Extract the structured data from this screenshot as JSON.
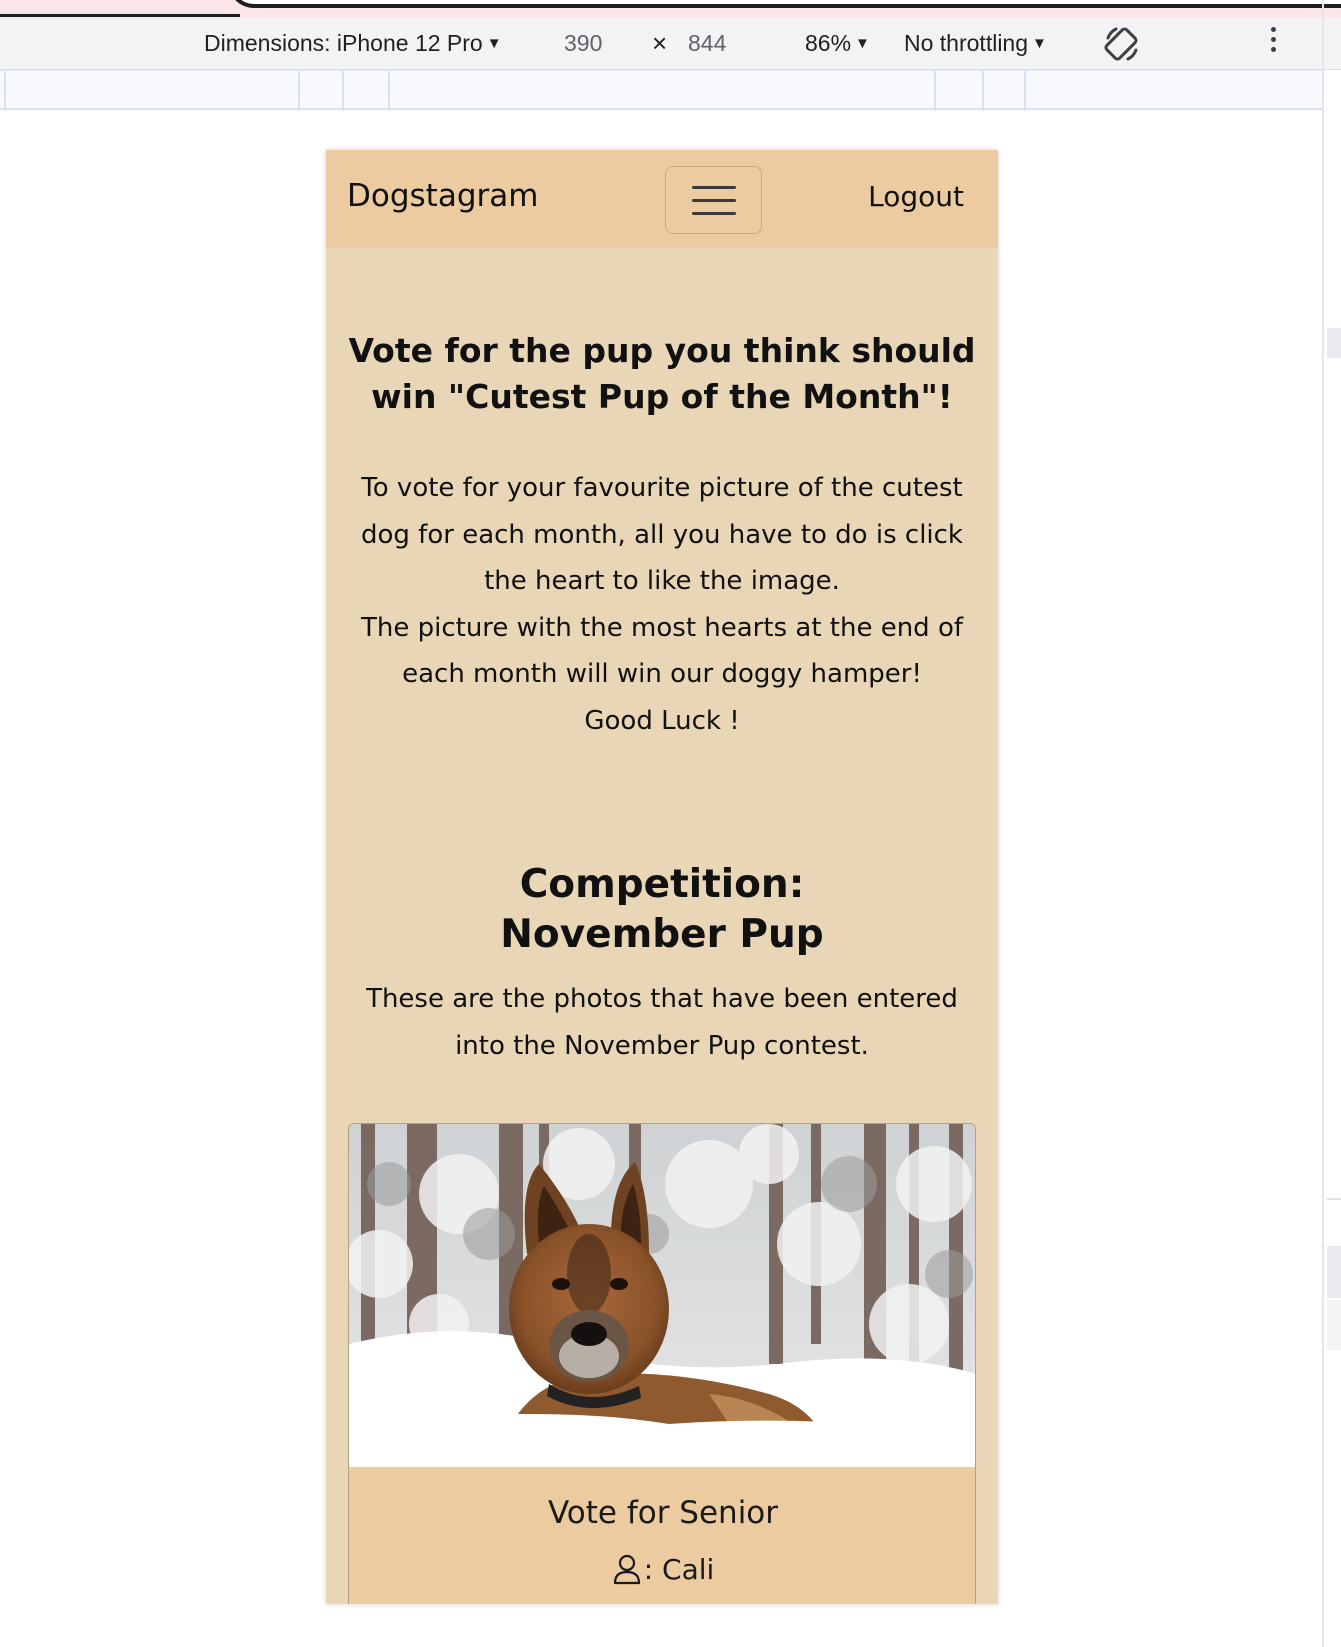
{
  "devtools": {
    "dimensions_label": "Dimensions: iPhone 12 Pro",
    "width": "390",
    "times": "×",
    "height": "844",
    "zoom": "86%",
    "throttling": "No throttling"
  },
  "navbar": {
    "brand": "Dogstagram",
    "logout": "Logout"
  },
  "intro": {
    "title": "Vote for the pup you think should win \"Cutest Pup of the Month\"!",
    "line1": "To vote for your favourite picture of the cutest dog for each month, all you have to do is click the heart to like the image.",
    "line2": "The picture with the most hearts at the end of each month will win our doggy hamper!",
    "line3": "Good Luck !"
  },
  "competition": {
    "heading": "Competition:",
    "name": "November Pup",
    "description": "These are the photos that have been entered into the November Pup contest."
  },
  "entries": [
    {
      "vote_label": "Vote for Senior",
      "owner_prefix": ": ",
      "owner": "Cali",
      "owner_icon": "user-icon"
    }
  ],
  "colors": {
    "navbar": "#ebcb9f",
    "page_background": "#e8d6b6",
    "card_body": "#ebcb9f"
  }
}
